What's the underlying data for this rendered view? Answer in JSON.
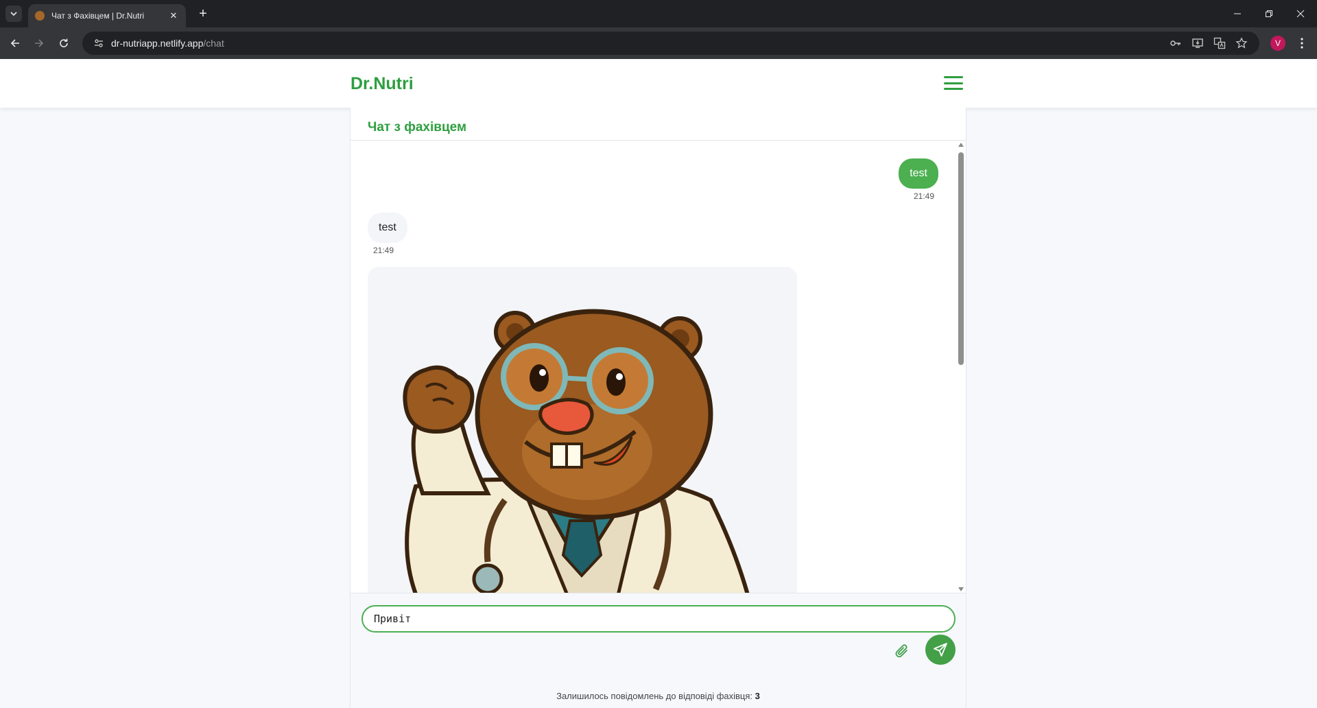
{
  "browser": {
    "tab_title": "Чат з Фахівцем | Dr.Nutri",
    "url_host": "dr-nutriapp.netlify.app",
    "url_path": "/chat",
    "profile_initial": "V",
    "icons": [
      "tab-list-icon",
      "favicon-icon",
      "tab-close-icon",
      "new-tab-icon",
      "minimize-icon",
      "maximize-icon",
      "window-close-icon",
      "back-icon",
      "forward-icon",
      "reload-icon",
      "site-info-icon",
      "password-key-icon",
      "install-app-icon",
      "translate-icon",
      "bookmark-star-icon",
      "menu-dots-icon"
    ]
  },
  "header": {
    "brand": "Dr.Nutri",
    "menu_icon": "hamburger-menu-icon"
  },
  "chat": {
    "title": "Чат з фахівцем",
    "messages": [
      {
        "direction": "outgoing",
        "text": "test",
        "time": "21:49"
      },
      {
        "direction": "incoming",
        "text": "test",
        "time": "21:49"
      },
      {
        "direction": "incoming",
        "type": "image",
        "image_subject": "cartoon-beaver-doctor-illustration"
      }
    ]
  },
  "composer": {
    "input_value": "Привіт",
    "attach_icon": "paperclip-icon",
    "send_icon": "send-icon",
    "remaining_label": "Залишилось повідомлень до відповіді фахівця:",
    "remaining_count": "3"
  },
  "colors": {
    "brand_green": "#2e9e3f",
    "bubble_out": "#4caf50",
    "send_button": "#43a047",
    "bubble_in": "#f3f5f8"
  }
}
